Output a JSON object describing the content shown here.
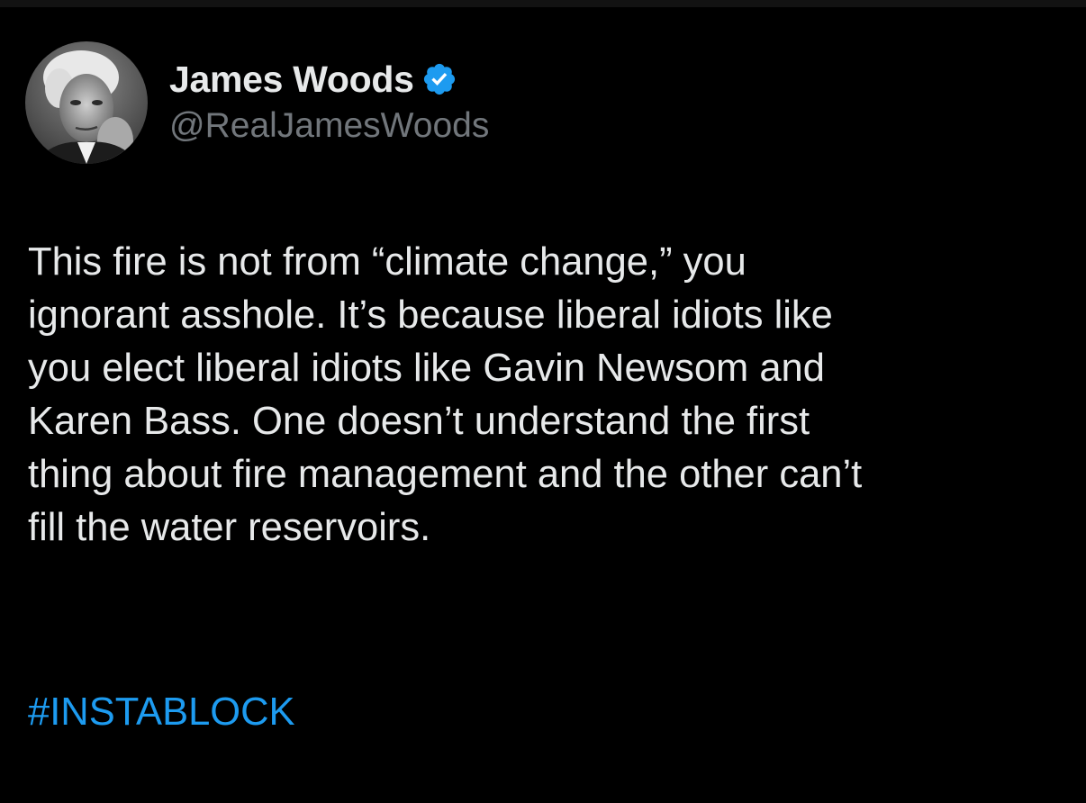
{
  "tweet": {
    "author": {
      "display_name": "James Woods",
      "handle": "@RealJamesWoods",
      "verified": true,
      "verified_icon": "verified-badge-icon",
      "verified_color": "#1d9bf0"
    },
    "text": "This fire is not from “climate change,” you\nignorant asshole. It’s because liberal idiots like\nyou elect liberal idiots like Gavin Newsom and\nKaren Bass. One doesn’t understand the first\nthing about fire management and the other can’t\nfill the water reservoirs.",
    "hashtag": "#INSTABLOCK"
  },
  "colors": {
    "background": "#000000",
    "text_primary": "#e7e9ea",
    "text_secondary": "#71767b",
    "link": "#1d9bf0"
  }
}
